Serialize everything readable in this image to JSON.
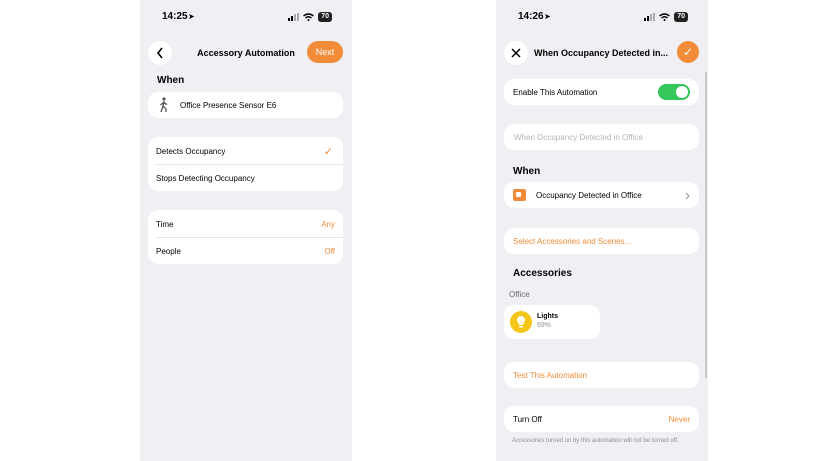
{
  "left": {
    "status_time": "14:25",
    "battery": "70",
    "nav_title": "Accessory Automation",
    "next_label": "Next",
    "when_heading": "When",
    "sensor_name": "Office Presence Sensor E6",
    "options": [
      "Detects Occupancy",
      "Stops Detecting Occupancy"
    ],
    "selected_option": "Detects Occupancy",
    "conditions": [
      {
        "label": "Time",
        "value": "Any"
      },
      {
        "label": "People",
        "value": "Off"
      }
    ]
  },
  "right": {
    "status_time": "14:26",
    "battery": "70",
    "nav_title": "When Occupancy Detected in...",
    "enable_label": "Enable This Automation",
    "enable_on": true,
    "name_placeholder": "When Occupancy Detected in Office",
    "when_heading": "When",
    "trigger_label": "Occupancy Detected in Office",
    "select_label": "Select Accessories and Scenes...",
    "accessories_heading": "Accessories",
    "room_label": "Office",
    "accessory": {
      "name": "Lights",
      "state": "69%"
    },
    "test_label": "Test This Automation",
    "turn_off_label": "Turn Off",
    "turn_off_value": "Never",
    "footnote": "Accessories turned on by this automation will not be turned off."
  },
  "colors": {
    "accent": "#f28c38",
    "toggle_on": "#34c759",
    "background": "#efeff4",
    "bulb": "#f5c518"
  },
  "icons": [
    "location-arrow-icon",
    "signal-icon",
    "wifi-icon",
    "battery-icon",
    "back-chevron-icon",
    "walking-person-icon",
    "checkmark-icon",
    "close-icon",
    "sensor-tile-icon",
    "chevron-right-icon",
    "lightbulb-icon"
  ]
}
